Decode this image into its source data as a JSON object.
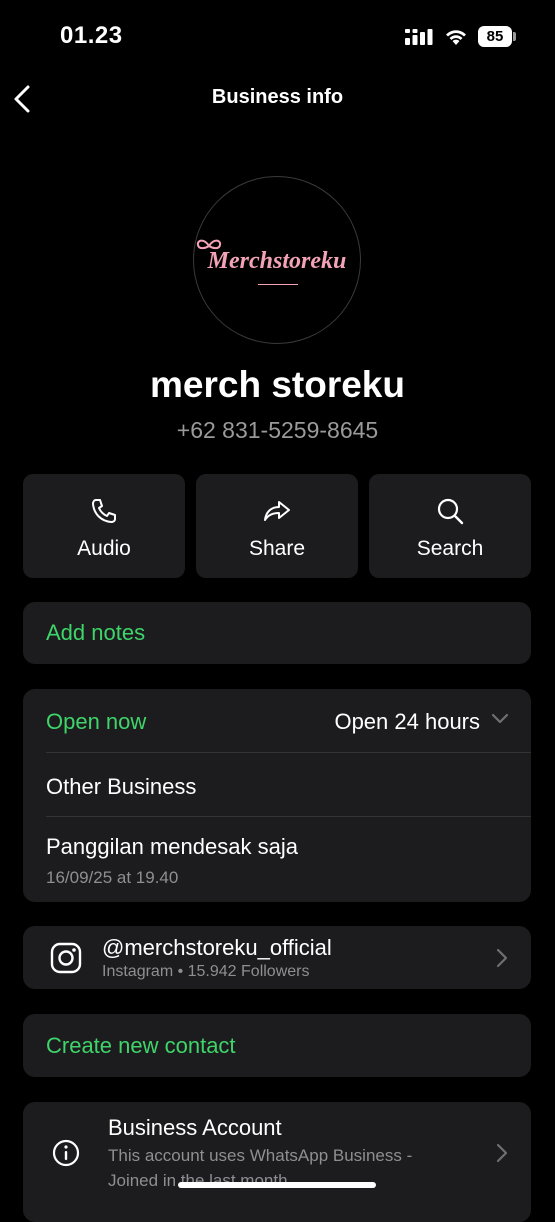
{
  "status": {
    "time": "01.23",
    "battery": "85"
  },
  "nav": {
    "title": "Business info"
  },
  "profile": {
    "logo_text": "Merchstoreku",
    "name": "merch storeku",
    "phone": "+62 831-5259-8645"
  },
  "actions": [
    {
      "label": "Audio",
      "icon": "phone-icon"
    },
    {
      "label": "Share",
      "icon": "share-arrow-icon"
    },
    {
      "label": "Search",
      "icon": "search-icon"
    }
  ],
  "notes": {
    "label": "Add notes"
  },
  "hours": {
    "status": "Open now",
    "value": "Open 24 hours",
    "category": "Other Business",
    "message": "Panggilan mendesak saja",
    "message_time": "16/09/25 at 19.40"
  },
  "instagram": {
    "handle": "@merchstoreku_official",
    "detail": "Instagram • 15.942 Followers"
  },
  "create_contact": {
    "label": "Create new contact"
  },
  "business_account": {
    "title": "Business Account",
    "line1": "This account uses WhatsApp Business -",
    "line2": "Joined in the last month"
  },
  "colors": {
    "accent_green": "#3ed46a",
    "card_bg": "#1c1c1e",
    "logo_pink": "#f4a3b7"
  }
}
